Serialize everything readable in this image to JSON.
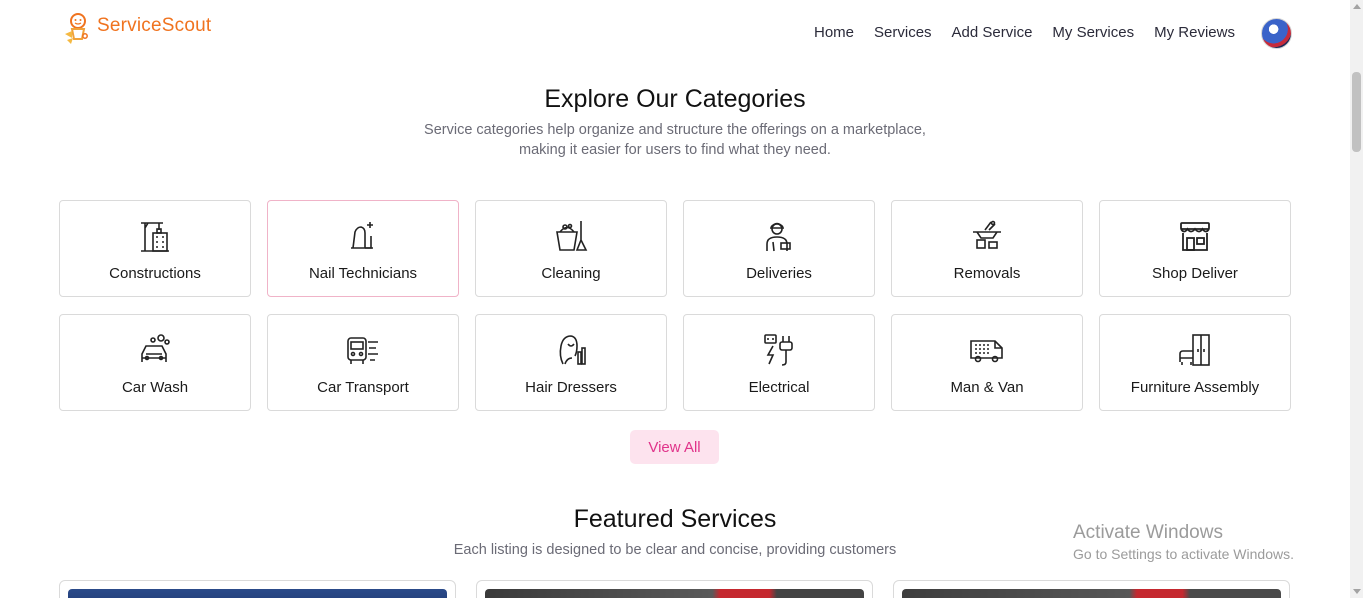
{
  "brand": {
    "name": "ServiceScout",
    "accent": "#f0731f"
  },
  "nav": {
    "items": [
      "Home",
      "Services",
      "Add Service",
      "My Services",
      "My Reviews"
    ]
  },
  "categories_section": {
    "title": "Explore Our Categories",
    "subtitle_line1": "Service categories help organize and structure the offerings on a marketplace,",
    "subtitle_line2": "making it easier for users to find what they need.",
    "items": [
      {
        "label": "Constructions",
        "icon": "crane-building-icon"
      },
      {
        "label": "Nail Technicians",
        "icon": "nail-polish-icon",
        "active": true
      },
      {
        "label": "Cleaning",
        "icon": "cleaning-bucket-icon"
      },
      {
        "label": "Deliveries",
        "icon": "delivery-person-icon"
      },
      {
        "label": "Removals",
        "icon": "removals-tools-icon"
      },
      {
        "label": "Shop Deliver",
        "icon": "storefront-icon"
      },
      {
        "label": "Car Wash",
        "icon": "car-wash-icon"
      },
      {
        "label": "Car Transport",
        "icon": "car-transport-icon"
      },
      {
        "label": "Hair Dressers",
        "icon": "hair-dresser-icon"
      },
      {
        "label": "Electrical",
        "icon": "electrical-plug-icon"
      },
      {
        "label": "Man & Van",
        "icon": "van-icon"
      },
      {
        "label": "Furniture Assembly",
        "icon": "furniture-icon"
      }
    ],
    "view_all_label": "View All",
    "active_border_color": "#f0b3c8",
    "button_color": "#e0338a"
  },
  "featured_section": {
    "title": "Featured Services",
    "subtitle": "Each listing is designed to be clear and concise, providing customers"
  },
  "watermark": {
    "line1": "Activate Windows",
    "line2": "Go to Settings to activate Windows."
  }
}
